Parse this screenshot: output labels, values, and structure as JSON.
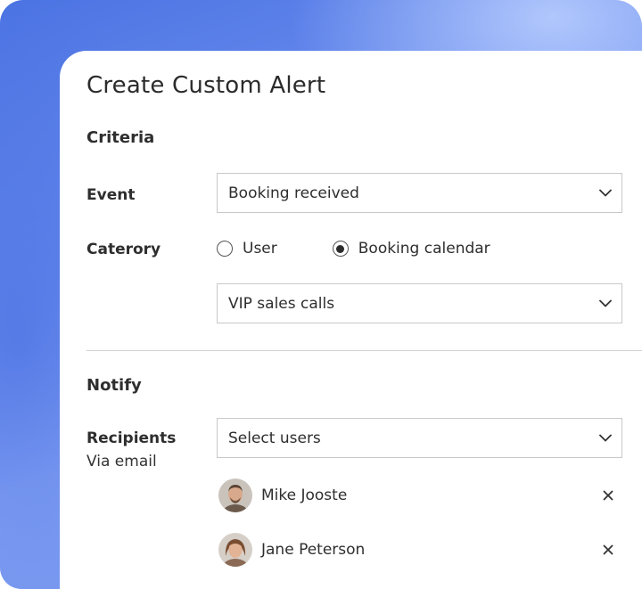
{
  "dialog": {
    "title": "Create Custom Alert"
  },
  "criteria": {
    "heading": "Criteria",
    "event_label": "Event",
    "event_value": "Booking received",
    "category_label": "Caterory",
    "category_options": [
      {
        "label": "User",
        "selected": false
      },
      {
        "label": "Booking calendar",
        "selected": true
      }
    ],
    "calendar_value": "VIP sales calls"
  },
  "notify": {
    "heading": "Notify",
    "recipients_label": "Recipients",
    "recipients_sublabel": "Via email",
    "select_placeholder": "Select users",
    "users": [
      {
        "name": "Mike Jooste"
      },
      {
        "name": "Jane Peterson"
      }
    ]
  },
  "colors": {
    "background_gradient": [
      "#4b73e2",
      "#8aa7f6"
    ],
    "text": "#2e2e2e",
    "border": "#c9c9c9"
  },
  "icons": {
    "dropdown": "chevron-down-icon",
    "remove": "close-icon"
  }
}
